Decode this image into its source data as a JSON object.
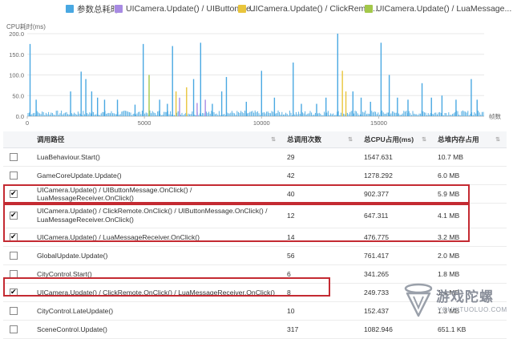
{
  "legend": [
    {
      "label": "参数总耗时",
      "color": "#49a8e2"
    },
    {
      "label": "UICamera.Update() / UIButtonMe...",
      "color": "#a88be3"
    },
    {
      "label": "UICamera.Update() / ClickRemot...",
      "color": "#e9c53c"
    },
    {
      "label": "UICamera.Update() / LuaMessage...",
      "color": "#a3c84a"
    }
  ],
  "chart_data": {
    "type": "bar",
    "ylabel": "CPU耗时(ms)",
    "xlabel": "帧数",
    "ylim": [
      0,
      200
    ],
    "yticks": [
      "200.0",
      "150.0",
      "100.0",
      "50.0",
      "0.0"
    ],
    "xticks": [
      "0",
      "5000",
      "10000",
      "15000"
    ],
    "xlim": [
      0,
      19500
    ],
    "spikes": [
      {
        "x": 120,
        "v": 175,
        "s": 0
      },
      {
        "x": 380,
        "v": 40,
        "s": 0
      },
      {
        "x": 1850,
        "v": 60,
        "s": 0
      },
      {
        "x": 2300,
        "v": 108,
        "s": 0
      },
      {
        "x": 2500,
        "v": 90,
        "s": 0
      },
      {
        "x": 2750,
        "v": 60,
        "s": 0
      },
      {
        "x": 3000,
        "v": 45,
        "s": 0
      },
      {
        "x": 3300,
        "v": 40,
        "s": 0
      },
      {
        "x": 3850,
        "v": 40,
        "s": 0
      },
      {
        "x": 4600,
        "v": 28,
        "s": 0
      },
      {
        "x": 4950,
        "v": 175,
        "s": 0
      },
      {
        "x": 5200,
        "v": 100,
        "s": 3
      },
      {
        "x": 5650,
        "v": 40,
        "s": 0
      },
      {
        "x": 5980,
        "v": 30,
        "s": 0
      },
      {
        "x": 6200,
        "v": 170,
        "s": 0
      },
      {
        "x": 6350,
        "v": 60,
        "s": 2
      },
      {
        "x": 6500,
        "v": 45,
        "s": 1
      },
      {
        "x": 6800,
        "v": 70,
        "s": 2
      },
      {
        "x": 7100,
        "v": 90,
        "s": 0
      },
      {
        "x": 7250,
        "v": 32,
        "s": 1
      },
      {
        "x": 7400,
        "v": 178,
        "s": 0
      },
      {
        "x": 7600,
        "v": 40,
        "s": 1
      },
      {
        "x": 7900,
        "v": 30,
        "s": 0
      },
      {
        "x": 8300,
        "v": 60,
        "s": 0
      },
      {
        "x": 8500,
        "v": 95,
        "s": 0
      },
      {
        "x": 9350,
        "v": 35,
        "s": 0
      },
      {
        "x": 10000,
        "v": 110,
        "s": 0
      },
      {
        "x": 10550,
        "v": 45,
        "s": 0
      },
      {
        "x": 11350,
        "v": 130,
        "s": 0
      },
      {
        "x": 11700,
        "v": 30,
        "s": 0
      },
      {
        "x": 12350,
        "v": 30,
        "s": 0
      },
      {
        "x": 12750,
        "v": 45,
        "s": 0
      },
      {
        "x": 13250,
        "v": 200,
        "s": 0
      },
      {
        "x": 13450,
        "v": 110,
        "s": 2
      },
      {
        "x": 13600,
        "v": 60,
        "s": 2
      },
      {
        "x": 13900,
        "v": 60,
        "s": 0
      },
      {
        "x": 14250,
        "v": 45,
        "s": 0
      },
      {
        "x": 14650,
        "v": 35,
        "s": 0
      },
      {
        "x": 15100,
        "v": 178,
        "s": 0
      },
      {
        "x": 15450,
        "v": 100,
        "s": 0
      },
      {
        "x": 15800,
        "v": 45,
        "s": 0
      },
      {
        "x": 16250,
        "v": 40,
        "s": 0
      },
      {
        "x": 16850,
        "v": 80,
        "s": 0
      },
      {
        "x": 17250,
        "v": 45,
        "s": 0
      },
      {
        "x": 17700,
        "v": 50,
        "s": 0
      },
      {
        "x": 18300,
        "v": 40,
        "s": 0
      },
      {
        "x": 18950,
        "v": 90,
        "s": 0
      },
      {
        "x": 19200,
        "v": 40,
        "s": 0
      }
    ]
  },
  "table": {
    "headers": [
      "调用路径",
      "总调用次数",
      "总CPU占用(ms)",
      "总堆内存占用"
    ],
    "rows": [
      {
        "checked": false,
        "path": "LuaBehaviour.Start()",
        "calls": "29",
        "cpu": "1547.631",
        "mem": "10.7 MB"
      },
      {
        "checked": false,
        "path": "GameCoreUpdate.Update()",
        "calls": "42",
        "cpu": "1278.292",
        "mem": "6.0 MB"
      },
      {
        "checked": true,
        "path": "UICamera.Update() / UIButtonMessage.OnClick() / LuaMessageReceiver.OnClick()",
        "calls": "40",
        "cpu": "902.377",
        "mem": "5.9 MB"
      },
      {
        "checked": true,
        "path": "UICamera.Update() / ClickRemote.OnClick() / UIButtonMessage.OnClick() / LuaMessageReceiver.OnClick()",
        "calls": "12",
        "cpu": "647.311",
        "mem": "4.1 MB"
      },
      {
        "checked": true,
        "path": "UICamera.Update() / LuaMessageReceiver.OnClick()",
        "calls": "14",
        "cpu": "476.775",
        "mem": "3.2 MB"
      },
      {
        "checked": false,
        "path": "GlobalUpdate.Update()",
        "calls": "56",
        "cpu": "761.417",
        "mem": "2.0 MB"
      },
      {
        "checked": false,
        "path": "CityControl.Start()",
        "calls": "6",
        "cpu": "341.265",
        "mem": "1.8 MB"
      },
      {
        "checked": true,
        "path": "UICamera.Update() / ClickRemote.OnClick() / LuaMessageReceiver.OnClick()",
        "calls": "8",
        "cpu": "249.733",
        "mem": "1.4 MB"
      },
      {
        "checked": false,
        "path": "CityControl.LateUpdate()",
        "calls": "10",
        "cpu": "152.437",
        "mem": "1.3 MB"
      },
      {
        "checked": false,
        "path": "SceneControl.Update()",
        "calls": "317",
        "cpu": "1082.946",
        "mem": "651.1 KB"
      }
    ]
  },
  "watermark": {
    "title": "游戏陀螺",
    "url": "YOUXITUOLUO.COM"
  }
}
